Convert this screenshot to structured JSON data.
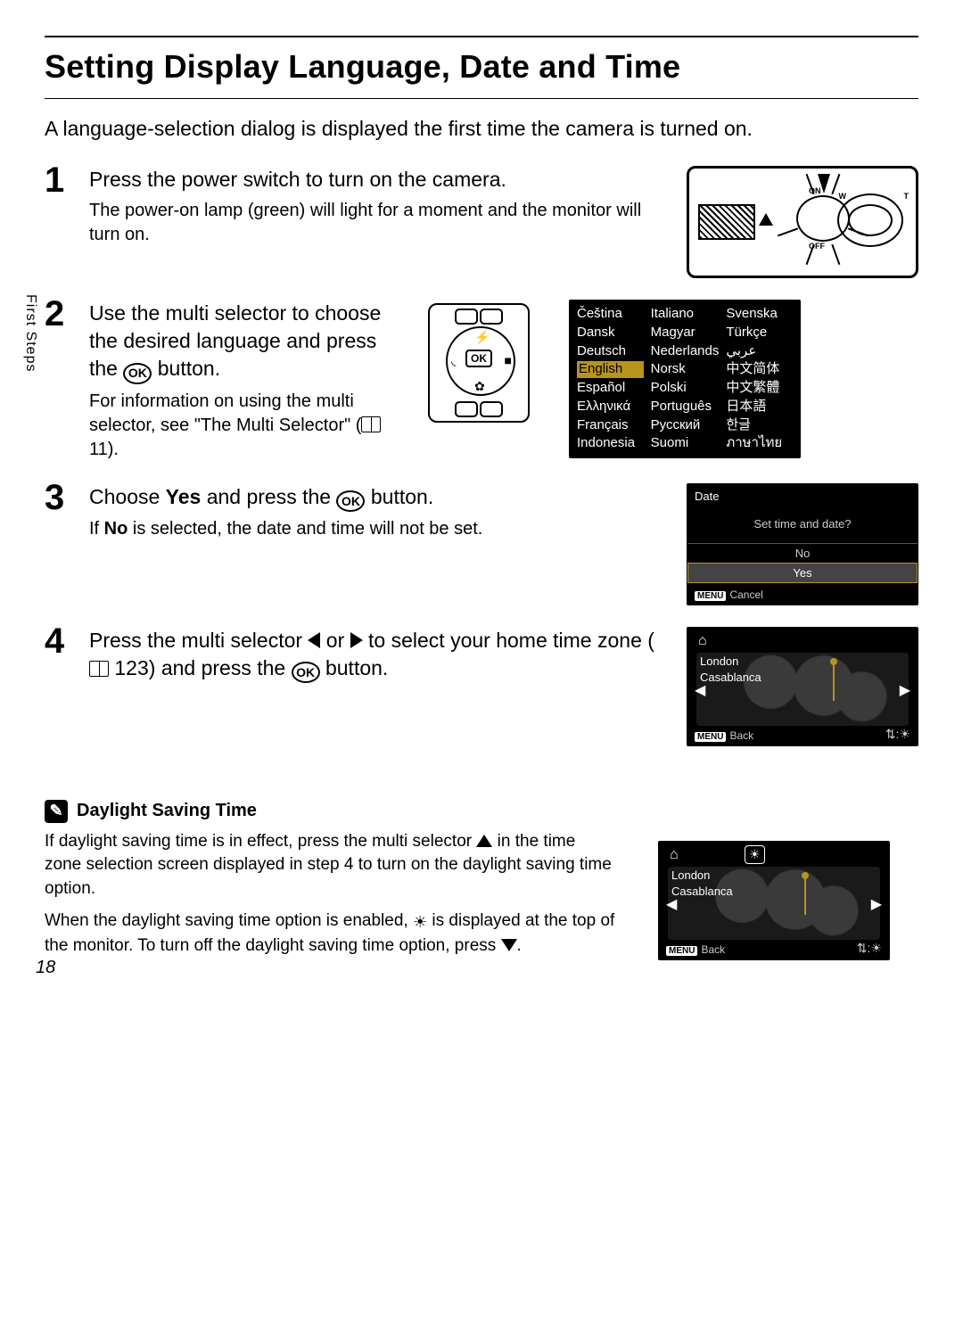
{
  "sideTab": "First Steps",
  "title": "Setting Display Language, Date and Time",
  "intro": "A language-selection dialog is displayed the first time the camera is turned on.",
  "pageNumber": "18",
  "okLabel": "OK",
  "cameraLabels": {
    "on": "ON",
    "off": "OFF",
    "w": "W",
    "t": "T"
  },
  "steps": {
    "s1": {
      "num": "1",
      "head": "Press the power switch to turn on the camera.",
      "sub": "The power-on lamp (green) will light for a moment and the monitor will turn on."
    },
    "s2": {
      "num": "2",
      "headA": "Use the multi selector to choose the desired language and press the ",
      "headB": " button.",
      "subA": "For information on using the multi selector, see \"The Multi Selector\" (",
      "subRef": " 11).",
      "languages": {
        "col1": [
          "Čeština",
          "Dansk",
          "Deutsch",
          "English",
          "Español",
          "Ελληνικά",
          "Français",
          "Indonesia"
        ],
        "col2": [
          "Italiano",
          "Magyar",
          "Nederlands",
          "Norsk",
          "Polski",
          "Português",
          "Русский",
          "Suomi"
        ],
        "col3": [
          "Svenska",
          "Türkçe",
          "عربي",
          "中文简体",
          "中文繁體",
          "日本語",
          "한글",
          "ภาษาไทย"
        ]
      },
      "selected": "English"
    },
    "s3": {
      "num": "3",
      "headA": "Choose ",
      "headBold": "Yes",
      "headB": " and press the ",
      "headC": " button.",
      "subA": "If ",
      "subBold": "No",
      "subB": " is selected, the date and time will not be set.",
      "lcd": {
        "title": "Date",
        "prompt": "Set time and date?",
        "optNo": "No",
        "optYes": "Yes",
        "menu": "MENU",
        "cancel": "Cancel"
      }
    },
    "s4": {
      "num": "4",
      "headA": "Press the multi selector ",
      "headB": " or ",
      "headC": " to select your home time zone (",
      "headRef": " 123) and press the ",
      "headD": " button.",
      "lcd": {
        "city1": "London",
        "city2": "Casablanca",
        "menu": "MENU",
        "back": "Back"
      }
    }
  },
  "note": {
    "heading": "Daylight Saving Time",
    "p1a": "If daylight saving time is in effect, press the multi selector ",
    "p1b": " in the time zone selection screen displayed in step 4 to turn on the daylight saving time option.",
    "p2a": "When the daylight saving time option is enabled, ",
    "p2b": " is displayed at the top of the monitor. To turn off the daylight saving time option, press ",
    "p2c": ".",
    "lcd": {
      "city1": "London",
      "city2": "Casablanca",
      "menu": "MENU",
      "back": "Back"
    }
  }
}
